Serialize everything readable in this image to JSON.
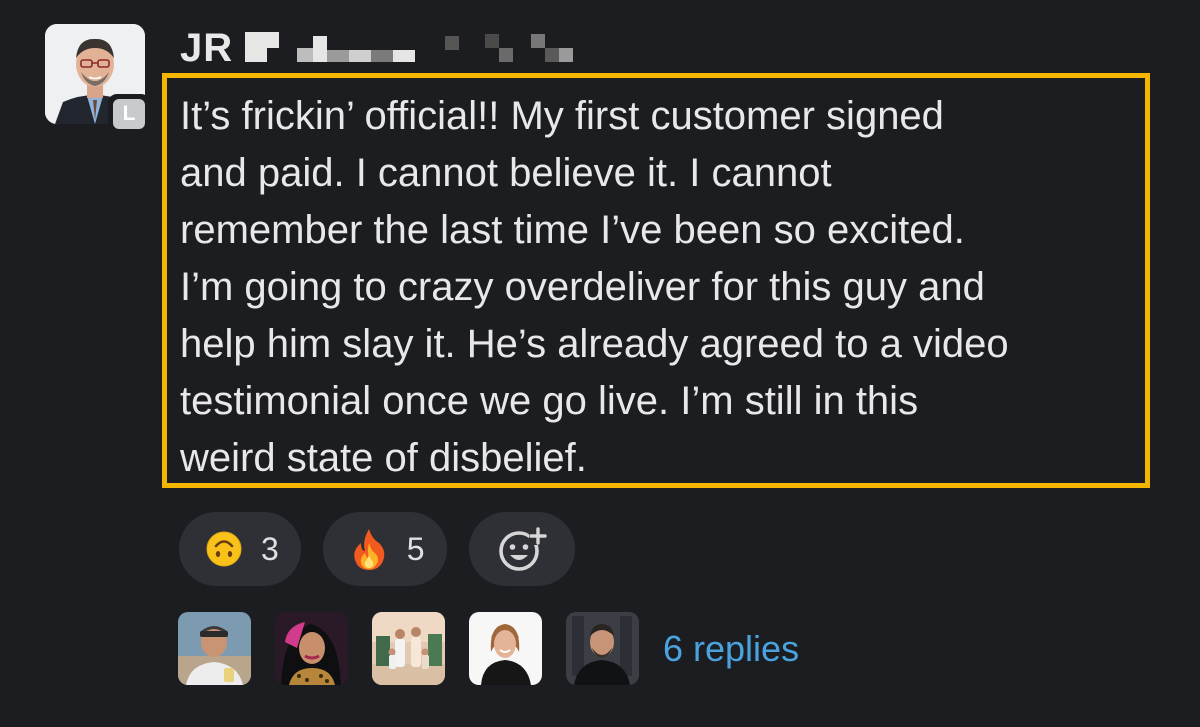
{
  "sender": {
    "name": "JR",
    "initial_badge": "L"
  },
  "message": {
    "text": "It’s frickin’ official!! My first customer signed\nand paid. I cannot believe it. I cannot\nremember the last time I’ve been so excited.\nI’m going to crazy overdeliver for this guy and\nhelp him slay it. He’s already agreed to a video\ntestimonial once we go live. I’m still in this\nweird state of disbelief.",
    "highlight_color": "#f5b400"
  },
  "reactions": [
    {
      "icon": "upside-down-face-icon",
      "count": "3"
    },
    {
      "icon": "fire-icon",
      "count": "5"
    },
    {
      "icon": "add-reaction-icon"
    }
  ],
  "replies": {
    "label": "6 replies",
    "link_color": "#4aa3df",
    "avatars": [
      "reply-avatar-1",
      "reply-avatar-2",
      "reply-avatar-3",
      "reply-avatar-4",
      "reply-avatar-5"
    ]
  },
  "colors": {
    "background": "#1b1d21",
    "pill": "#2e3035"
  }
}
